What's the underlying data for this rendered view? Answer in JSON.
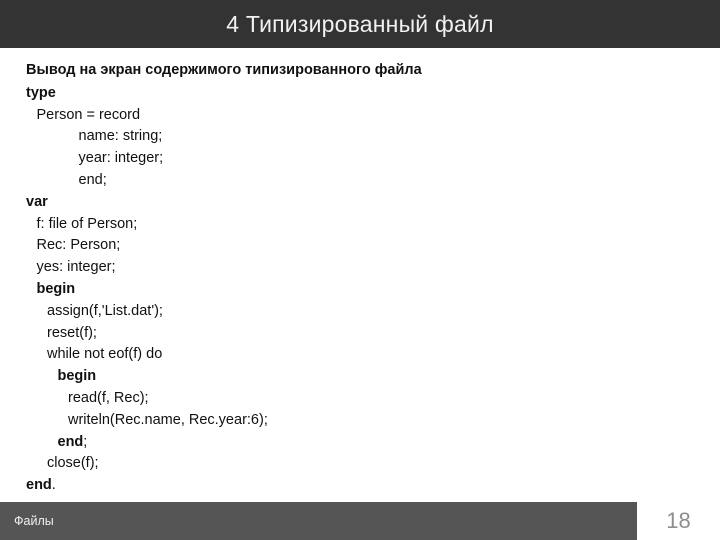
{
  "header": {
    "title": "4 Типизированный файл",
    "background_color": "#333333",
    "text_color": "#f1f1f1"
  },
  "body": {
    "subtitle": "Вывод на экран содержимого типизированного файла",
    "code_lines": [
      {
        "indent": 0,
        "bold": true,
        "text": "type"
      },
      {
        "indent": 1,
        "bold": false,
        "text": "Person = record"
      },
      {
        "indent": 5,
        "bold": false,
        "text": "name: string;"
      },
      {
        "indent": 5,
        "bold": false,
        "text": "year: integer;"
      },
      {
        "indent": 5,
        "bold": false,
        "text": "end;"
      },
      {
        "indent": 0,
        "bold": true,
        "text": "var"
      },
      {
        "indent": 1,
        "bold": false,
        "text": "f: file of Person;"
      },
      {
        "indent": 1,
        "bold": false,
        "text": "Rec: Person;"
      },
      {
        "indent": 1,
        "bold": false,
        "text": "yes: integer;"
      },
      {
        "indent": 1,
        "bold": true,
        "text": "begin"
      },
      {
        "indent": 2,
        "bold": false,
        "text": "assign(f,'List.dat');"
      },
      {
        "indent": 2,
        "bold": false,
        "text": "reset(f);"
      },
      {
        "indent": 2,
        "bold": false,
        "text": "while not eof(f) do"
      },
      {
        "indent": 3,
        "bold": true,
        "text": "begin"
      },
      {
        "indent": 4,
        "bold": false,
        "text": "read(f, Rec);"
      },
      {
        "indent": 4,
        "bold": false,
        "text": "writeln(Rec.name, Rec.year:6);"
      },
      {
        "indent": 3,
        "bold": true,
        "text": "end",
        "suffix": ";"
      },
      {
        "indent": 2,
        "bold": false,
        "text": "close(f);"
      },
      {
        "indent": 0,
        "bold": true,
        "text": "end",
        "suffix": "."
      }
    ]
  },
  "footer": {
    "label": "Файлы",
    "page_number": "18",
    "bar_color": "#555555",
    "label_color": "#f0f0f0",
    "page_number_color": "#8d8d8d"
  }
}
